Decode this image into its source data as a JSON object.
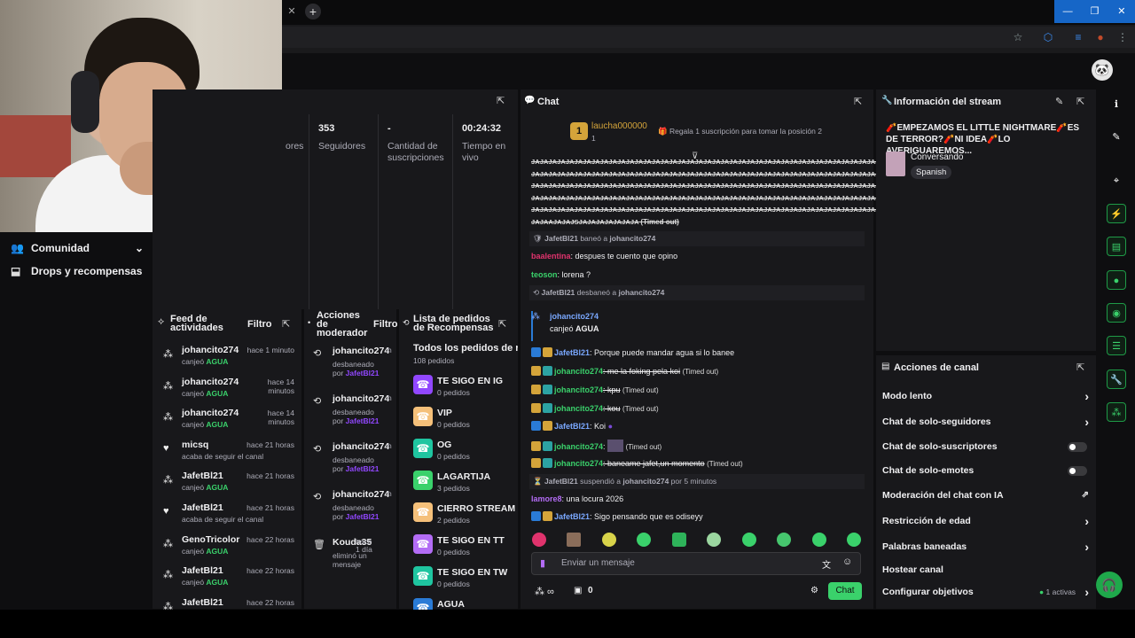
{
  "colors": {
    "accent_green": "#3ad16b",
    "purple": "#9147ff",
    "panel": "#18181b",
    "bg": "#0e0e10"
  },
  "leftnav": {
    "community": "Comunidad",
    "drops": "Drops y recompensas"
  },
  "stats": {
    "partial_label": "ores",
    "followers_value": "353",
    "followers_label": "Seguidores",
    "subs_value": "-",
    "subs_label": "Cantidad de suscripciones",
    "live_value": "00:24:32",
    "live_label": "Tiempo en vivo"
  },
  "feed": {
    "title": "Feed de actividades",
    "filter": "Filtro",
    "items": [
      {
        "icon": "bits-icon",
        "name": "johancito274",
        "time": "hace 1 minuto",
        "sub_prefix": "canjeó ",
        "sub_value": "AGUA"
      },
      {
        "icon": "bits-icon",
        "name": "johancito274",
        "time": "hace 14 minutos",
        "sub_prefix": "canjeó ",
        "sub_value": "AGUA"
      },
      {
        "icon": "bits-icon",
        "name": "johancito274",
        "time": "hace 14 minutos",
        "sub_prefix": "canjeó ",
        "sub_value": "AGUA"
      },
      {
        "icon": "heart-icon",
        "name": "micsq",
        "time": "hace 21 horas",
        "sub_prefix": "acaba de seguir el canal",
        "sub_value": ""
      },
      {
        "icon": "bits-icon",
        "name": "JafetBl21",
        "time": "hace 21 horas",
        "sub_prefix": "canjeó ",
        "sub_value": "AGUA"
      },
      {
        "icon": "heart-icon",
        "name": "JafetBl21",
        "time": "hace 21 horas",
        "sub_prefix": "acaba de seguir el canal",
        "sub_value": ""
      },
      {
        "icon": "bits-icon",
        "name": "GenoTricolor",
        "time": "hace 22 horas",
        "sub_prefix": "canjeó ",
        "sub_value": "AGUA"
      },
      {
        "icon": "bits-icon",
        "name": "JafetBl21",
        "time": "hace 22 horas",
        "sub_prefix": "canjeó ",
        "sub_value": "AGUA"
      },
      {
        "icon": "bits-icon",
        "name": "JafetBl21",
        "time": "hace 22 horas",
        "sub_prefix": "",
        "sub_value": ""
      }
    ]
  },
  "modactions": {
    "title": "Acciones de moderador",
    "filter": "Filtro",
    "items": [
      {
        "name": "johancito274",
        "line1": "desbaneado",
        "line2": "por ",
        "by": "JafetBl21",
        "time": "h"
      },
      {
        "name": "johancito274",
        "line1": "desbaneado",
        "line2": "por ",
        "by": "JafetBl21",
        "time": "h"
      },
      {
        "name": "johancito274",
        "line1": "desbaneado",
        "line2": "por ",
        "by": "JafetBl21",
        "time": "h"
      },
      {
        "name": "johancito274",
        "line1": "desbaneado",
        "line2": "por ",
        "by": "JafetBl21",
        "time": "h"
      },
      {
        "name": "Kouda35",
        "line1": "eliminó un",
        "line2": "mensaje",
        "by": "",
        "time": "hace 1 día"
      }
    ]
  },
  "rewards": {
    "title": "Lista de pedidos de Recompensas",
    "all": "Todos los pedidos de re...",
    "all_count": "108 pedidos",
    "items": [
      {
        "name": "TE SIGO EN IG",
        "count": "0 pedidos",
        "color": "#9147ff"
      },
      {
        "name": "VIP",
        "count": "0 pedidos",
        "color": "#f5c07a"
      },
      {
        "name": "OG",
        "count": "0 pedidos",
        "color": "#1fc5a0"
      },
      {
        "name": "LAGARTIJA",
        "count": "3 pedidos",
        "color": "#3ad16b"
      },
      {
        "name": "CIERRO STREAM",
        "count": "2 pedidos",
        "color": "#f5c07a"
      },
      {
        "name": "TE SIGO EN TT",
        "count": "0 pedidos",
        "color": "#b36cf5"
      },
      {
        "name": "TE SIGO EN TW",
        "count": "0 pedidos",
        "color": "#1fc5a0"
      },
      {
        "name": "AGUA",
        "count": "",
        "color": "#2a7bd6"
      }
    ]
  },
  "chat": {
    "title": "Chat",
    "top_user": "laucha000000",
    "top_rank": "1",
    "top_sub_count": "1",
    "gift_text": "Regala 1 suscripción para tomar la posición 2",
    "spam_lines": [
      "JAJAJAJAJAJAJAJAJAJAJAJAJAJAJAJAJAJAJAJAJAJAJAJAJAJAJAJAJAJAJAJAJAJAJAJAJAJAJAJAJA",
      "JAJAJAJAJAJAJAJAJAJAJAJAJAJAJAJAJAJAJAJAJAJAJAJAJAJAJAJAJAJAJAJAJAJAJAJAJAJAJAJAJA",
      "JAJAJAJAJAJAJAJAJAJAJAJAJAJAJAJAJAJAJAJAJAJAJAJAJAJAJAJAJAJAJAJAJAJAJAJAJAJAJAJAJA",
      "JAJAJAJAJAJAJAJAJAJAJAJAJAJAJAJAJAJAJAJAJAJAJAJAJAJAJAJAJAJAJAJAJAJAJAJAJAJAJAJAJA",
      "JAJAJAJAJAJAJAJAJAJAJAJAJAJAJAJAJAJAJAJAJAJAJAJAJAJAJAJAJAJAJAJAJAJAJAJAJAJAJAJAJA",
      "JAJAAJAJAJSJAJAJAJAJAJAJA"
    ],
    "timed_out": "(Timed out)",
    "e1_user": "JafetBl21",
    "e1_verb": " baneó a ",
    "e1_target": "johancito274",
    "m1_user": "baalentina",
    "m1_text": ": despues te cuento que opino",
    "m2_user": "teoson",
    "m2_text": ": lorena ?",
    "e2_user": "JafetBl21",
    "e2_verb": " desbaneó a ",
    "e2_target": "johancito274",
    "r_user": "johancito274",
    "r_text": "canjeó ",
    "r_value": "AGUA",
    "m3_user": "JafetBl21",
    "m3_text": ": Porque puede mandar agua si lo banee",
    "m4_user": "johancito274",
    "m4_text": ": me la foking pela koi",
    "m5_user": "johancito274",
    "m5_text": ": kpu",
    "m6_user": "johancito274",
    "m6_text": ": kou",
    "m7_user": "JafetBl21",
    "m7_text": ": Koi",
    "m8_user": "johancito274",
    "m8_text": ":",
    "m9_user": "johancito274",
    "m9_text": ": baneame jafet,un momento",
    "e3_user": "JafetBl21",
    "e3_verb": " suspendió a ",
    "e3_target": "johancito274",
    "e3_tail": " por 5 minutos",
    "m10_user": "lamore8",
    "m10_text": ": una locura 2026",
    "m11_user": "JafetBl21",
    "m11_text": ": Sigo pensando que es odiseyy",
    "input_placeholder": "Enviar un mensaje",
    "points": "0",
    "send_label": "Chat"
  },
  "streaminfo": {
    "title": "Información del stream",
    "stream_title": "🧨EMPEZAMOS EL LITTLE NIGHTMARE🧨ES DE TERROR?🧨NI IDEA🧨LO AVERIGUAREMOS...",
    "category": "Conversando",
    "tag": "Spanish"
  },
  "channelactions": {
    "title": "Acciones de canal",
    "slow": "Modo lento",
    "followers": "Chat de solo-seguidores",
    "subs": "Chat de solo-suscriptores",
    "emotes": "Chat de solo-emotes",
    "ai": "Moderación del chat con IA",
    "age": "Restricción de edad",
    "banned": "Palabras baneadas",
    "host": "Hostear canal",
    "goals": "Configurar objetivos",
    "goals_active": "1 activas"
  }
}
